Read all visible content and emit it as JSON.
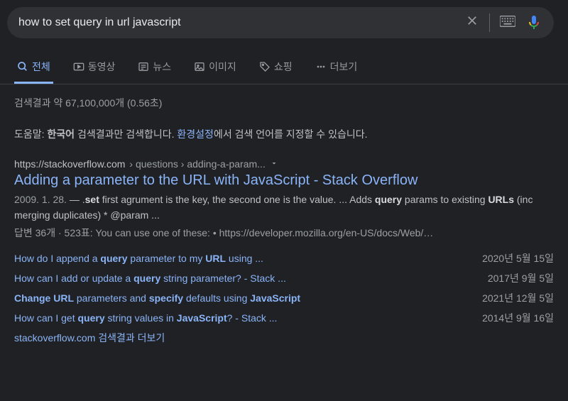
{
  "search": {
    "query": "how to set query in url javascript"
  },
  "tabs": {
    "all": "전체",
    "videos": "동영상",
    "news": "뉴스",
    "images": "이미지",
    "shopping": "쇼핑",
    "more": "더보기"
  },
  "stats": "검색결과 약 67,100,000개 (0.56초)",
  "tip": {
    "prefix": "도움말: ",
    "bold": "한국어",
    "mid": " 검색결과만 검색합니다. ",
    "link": "환경설정",
    "suffix": "에서 검색 언어를 지정할 수 있습니다."
  },
  "result": {
    "url_base": "https://stackoverflow.com",
    "url_path": " › questions › adding-a-param...",
    "title": "Adding a parameter to the URL with JavaScript - Stack Overflow",
    "date": "2009. 1. 28.",
    "sep": " — ",
    "snippet_p1": ".",
    "snippet_b1": "set",
    "snippet_p2": " first agrument is the key, the second one is the value. ... Adds ",
    "snippet_b2": "query",
    "snippet_p3": " params to existing ",
    "snippet_b3": "URLs",
    "snippet_p4": " (inc merging duplicates) * @param ...",
    "meta": "답변 36개 · 523표: You can use one of these: • https://developer.mozilla.org/en-US/docs/Web/…"
  },
  "related": [
    {
      "p1": "How do I append a ",
      "b1": "query",
      "p2": " parameter to my ",
      "b2": "URL",
      "p3": " using ...",
      "date": "2020년 5월 15일"
    },
    {
      "p1": "How can I add or update a ",
      "b1": "query",
      "p2": " string parameter? - Stack ...",
      "b2": "",
      "p3": "",
      "date": "2017년 9월 5일"
    },
    {
      "p1": "",
      "b1": "Change URL",
      "p2": " parameters and ",
      "b2": "specify",
      "p3": " defaults using ",
      "b3": "JavaScript",
      "date": "2021년 12월 5일"
    },
    {
      "p1": "How can I get ",
      "b1": "query",
      "p2": " string values in ",
      "b2": "JavaScript",
      "p3": "? - Stack ...",
      "date": "2014년 9월 16일"
    }
  ],
  "more_results": "stackoverflow.com 검색결과 더보기"
}
